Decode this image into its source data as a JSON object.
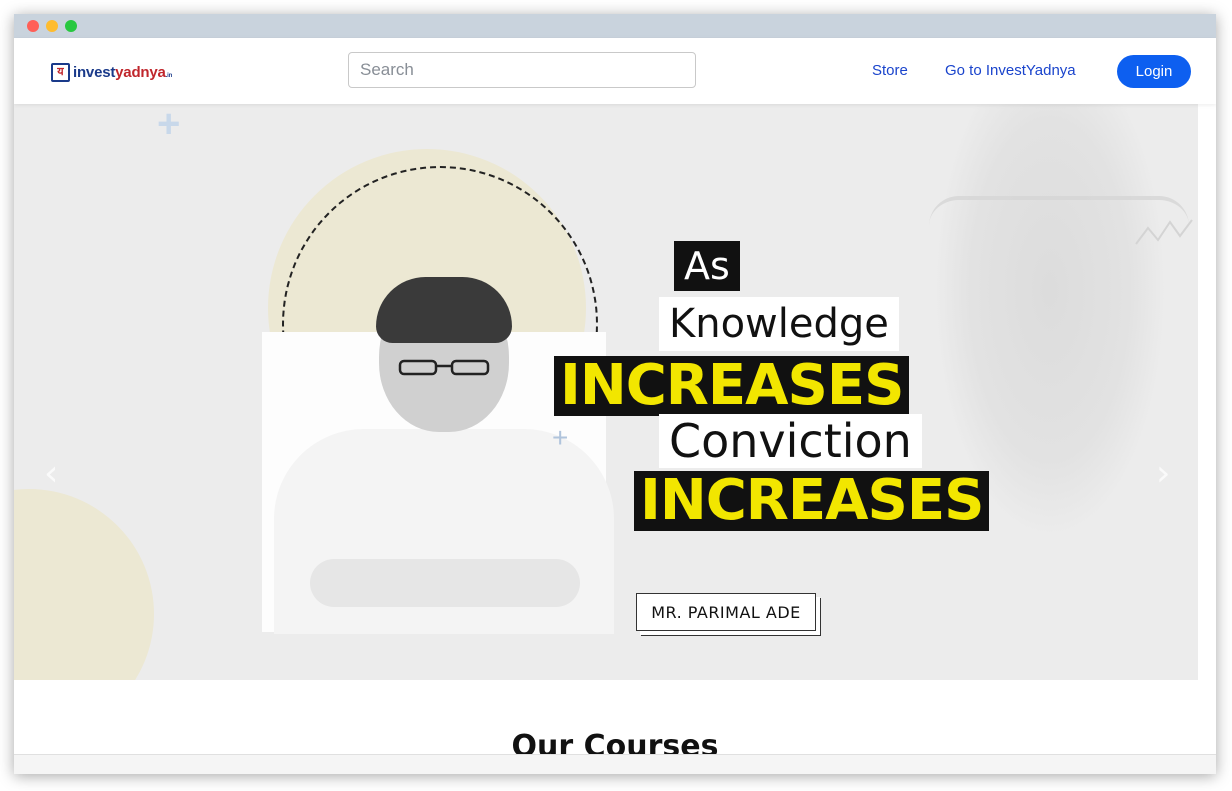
{
  "navbar": {
    "logo_mark": "य",
    "logo_text_main": "invest",
    "logo_text_accent": "yadnya",
    "logo_suffix": ".in",
    "search_placeholder": "Search",
    "links": {
      "store": "Store",
      "goto": "Go to InvestYadnya"
    },
    "login_label": "Login"
  },
  "hero": {
    "line1": "As",
    "line2": "Knowledge",
    "line3": "INCREASES",
    "line4": "Conviction",
    "line5": "INCREASES",
    "name_tag": "MR. PARIMAL ADE",
    "prev_arrow": "‹",
    "next_arrow": "›"
  },
  "courses": {
    "title": "Our Courses"
  },
  "colors": {
    "accent": "#0d5ff0",
    "link": "#1a44cc",
    "highlight_yellow": "#f2e600"
  }
}
